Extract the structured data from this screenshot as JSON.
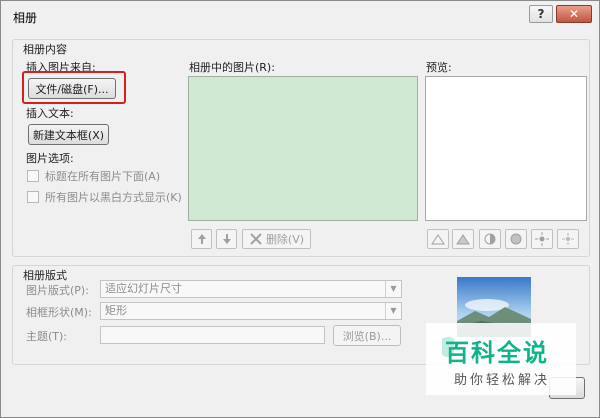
{
  "window": {
    "title": "相册",
    "help_label": "?",
    "close_label": "✕"
  },
  "album_content": {
    "group_label": "相册内容",
    "insert_picture_from_label": "插入图片来自:",
    "file_disk_button": "文件/磁盘(F)...",
    "insert_text_label": "插入文本:",
    "new_textbox_button": "新建文本框(X)",
    "picture_options_label": "图片选项:",
    "captions_below_label": "标题在所有图片下面(A)",
    "black_white_label": "所有图片以黑白方式显示(K)",
    "pictures_in_album_label": "相册中的图片(R):",
    "preview_label": "预览:",
    "remove_button": "删除(V)"
  },
  "album_layout": {
    "group_label": "相册版式",
    "picture_layout_label": "图片版式(P):",
    "picture_layout_value": "适应幻灯片尺寸",
    "frame_shape_label": "相框形状(M):",
    "frame_shape_value": "矩形",
    "theme_label": "主题(T):",
    "theme_value": "",
    "browse_button": "浏览(B)..."
  },
  "watermark": {
    "big_text": "百科全说",
    "small_text": "助你轻松解决"
  },
  "colors": {
    "accent_highlight": "#d42020",
    "listbox_bg": "#cfe8d2",
    "watermark_green": "#10b48a"
  }
}
